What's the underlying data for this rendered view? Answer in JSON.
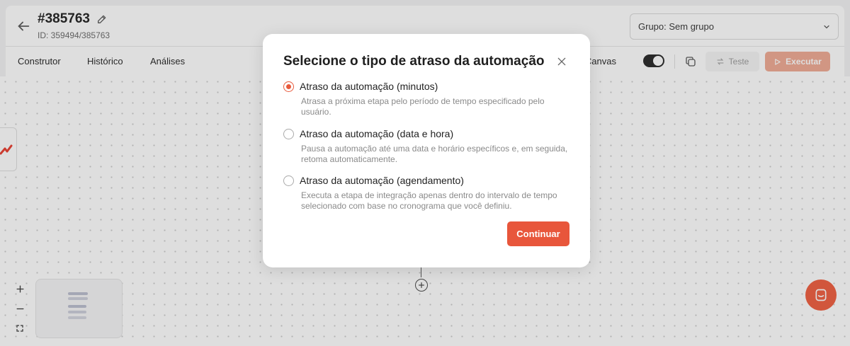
{
  "header": {
    "title": "#385763",
    "id_text": "ID: 359494/385763",
    "group_select": "Grupo: Sem grupo",
    "tabs": [
      "Construtor",
      "Histórico",
      "Análises"
    ],
    "canvas_label": "Canvas",
    "canvas_toggle_on": true,
    "test_label": "Teste",
    "run_label": "Executar"
  },
  "modal": {
    "title": "Selecione o tipo de atraso da automação",
    "options": [
      {
        "label": "Atraso da automação (minutos)",
        "description": "Atrasa a próxima etapa pelo período de tempo especificado pelo usuário.",
        "selected": true
      },
      {
        "label": "Atraso da automação (data e hora)",
        "description": "Pausa a automação até uma data e horário específicos e, em seguida, retoma automaticamente.",
        "selected": false
      },
      {
        "label": "Atraso da automação (agendamento)",
        "description": "Executa a etapa de integração apenas dentro do intervalo de tempo selecionado com base no cronograma que você definiu.",
        "selected": false
      }
    ],
    "continue_label": "Continuar"
  },
  "icons": {
    "back": "arrow-left-icon",
    "edit": "pencil-icon",
    "group_chevron": "chevron-down-icon",
    "copy": "copy-icon",
    "test": "swap-arrows-icon",
    "run": "play-icon",
    "close": "close-icon",
    "zoom_in": "plus-icon",
    "zoom_out": "minus-icon",
    "fit": "fit-view-icon",
    "add_node": "plus-circle-icon",
    "chat": "chat-icon"
  },
  "colors": {
    "accent": "#e8563b",
    "run_disabled": "#f0a890"
  }
}
